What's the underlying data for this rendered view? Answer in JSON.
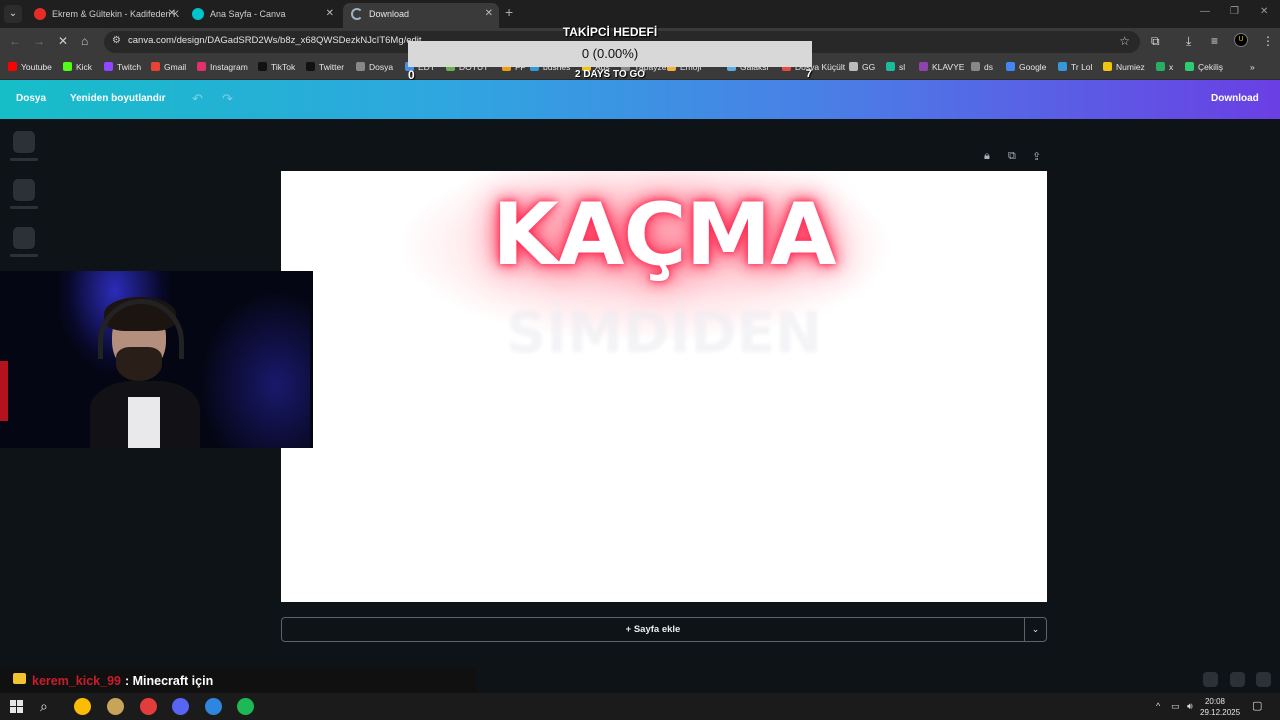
{
  "browser": {
    "tabs": [
      {
        "title": "Ekrem & Gültekin - Kadifeden K",
        "active": false,
        "icon": "youtube-favicon"
      },
      {
        "title": "Ana Sayfa - Canva",
        "active": false,
        "icon": "canva-favicon"
      },
      {
        "title": "Download",
        "active": true,
        "icon": "loading-favicon"
      }
    ],
    "url": "canva.com/design/DAGadSRD2Ws/b8z_x68QWSDezkNJcIT6Mg/edit",
    "bookmarks": [
      {
        "label": "Youtube",
        "color": "#ff0000"
      },
      {
        "label": "Kick",
        "color": "#53fc18"
      },
      {
        "label": "Twitch",
        "color": "#9146ff"
      },
      {
        "label": "Gmail",
        "color": "#ea4335"
      },
      {
        "label": "Instagram",
        "color": "#e1306c"
      },
      {
        "label": "TikTok",
        "color": "#111111"
      },
      {
        "label": "Twitter",
        "color": "#111111"
      },
      {
        "label": "Dosya",
        "color": "#888888"
      },
      {
        "label": "EDT",
        "color": "#4a90e2"
      },
      {
        "label": "DOTUT",
        "color": "#6ab04c"
      },
      {
        "label": "FF",
        "color": "#f39c12"
      },
      {
        "label": "busnes",
        "color": "#3498db"
      },
      {
        "label": "Ads",
        "color": "#f1c40f"
      },
      {
        "label": "Yapayzeka",
        "color": "#888888"
      },
      {
        "label": "Emoji",
        "color": "#f5b041"
      },
      {
        "label": "Galaksi",
        "color": "#5dade2"
      },
      {
        "label": "Dosya Küçült",
        "color": "#e74c3c"
      },
      {
        "label": "GG",
        "color": "#bbbbbb"
      },
      {
        "label": "sl",
        "color": "#1abc9c"
      },
      {
        "label": "KLAVYE",
        "color": "#8e44ad"
      },
      {
        "label": "ds",
        "color": "#888888"
      },
      {
        "label": "Google",
        "color": "#4285f4"
      },
      {
        "label": "Tr Lol",
        "color": "#3498db"
      },
      {
        "label": "Numiez",
        "color": "#f1c40f"
      },
      {
        "label": "x",
        "color": "#27ae60"
      },
      {
        "label": "Çekiliş",
        "color": "#2ecc71"
      }
    ]
  },
  "follower_goal": {
    "title": "TAKİPCİ HEDEFİ",
    "value_text": "0 (0.00%)",
    "progress_fraction": 0.0,
    "current": "0",
    "remaining": "2 DAYS TO GO",
    "target": "7"
  },
  "canva": {
    "menu_file": "Dosya",
    "menu_resize": "Yeniden boyutlandır",
    "download_label": "Download",
    "headline": "KAÇMA",
    "ghost_text": "SİMDİDEN",
    "add_page_label": "+ Sayfa ekle"
  },
  "chat": {
    "username": "kerem_kick_99",
    "message": ": Minecraft için"
  },
  "taskbar": {
    "time": "20:08",
    "date": "29.12.2025",
    "apps": [
      {
        "name": "chrome-icon",
        "color": "#fbbc04"
      },
      {
        "name": "league-icon",
        "color": "#c8a45a"
      },
      {
        "name": "app-icon",
        "color": "#e23c3c"
      },
      {
        "name": "discord-icon",
        "color": "#5865f2"
      },
      {
        "name": "paint-icon",
        "color": "#2e86de"
      },
      {
        "name": "spotify-icon",
        "color": "#1db954"
      }
    ]
  }
}
